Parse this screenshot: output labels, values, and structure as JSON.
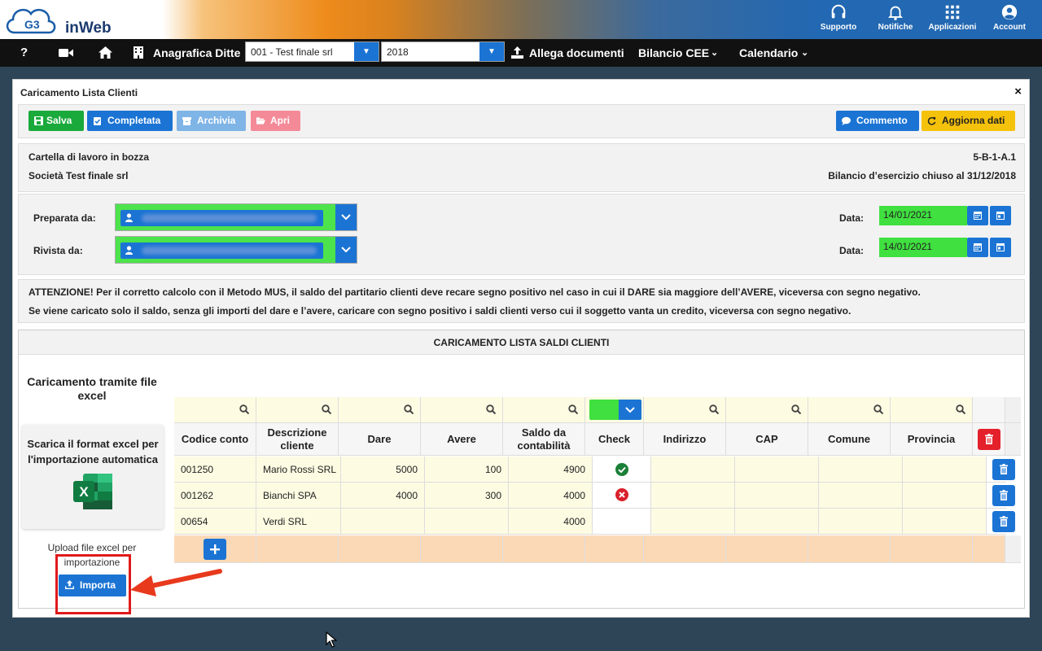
{
  "header": {
    "logo_badge": "G3",
    "logo_text": "inWeb",
    "items": [
      {
        "label": "Supporto",
        "icon": "headset-icon"
      },
      {
        "label": "Notifiche",
        "icon": "bell-icon"
      },
      {
        "label": "Applicazioni",
        "icon": "apps-grid-icon"
      },
      {
        "label": "Account",
        "icon": "account-icon"
      }
    ]
  },
  "nav": {
    "help": "?",
    "anagrafica": "Anagrafica Ditte",
    "company_select": "001 - Test finale srl",
    "year_select": "2018",
    "allega": "Allega documenti",
    "bilancio": "Bilancio CEE",
    "calendario": "Calendario"
  },
  "panel": {
    "title": "Caricamento Lista Clienti",
    "close": "×",
    "buttons": {
      "salva": "Salva",
      "completata": "Completata",
      "archivia": "Archivia",
      "apri": "Apri",
      "commento": "Commento",
      "aggiorna": "Aggiorna dati"
    },
    "info": {
      "status": "Cartella di lavoro in bozza",
      "company": "Società Test finale srl",
      "code": "5-B-1-A.1",
      "balance": "Bilancio d’esercizio chiuso al 31/12/2018"
    },
    "prep": {
      "preparata_label": "Preparata da:",
      "rivista_label": "Rivista da:",
      "data_label": "Data:",
      "preparata_date": "14/01/2021",
      "rivista_date": "14/01/2021"
    },
    "warning": {
      "line1": "ATTENZIONE! Per il corretto calcolo con il Metodo MUS, il saldo del partitario clienti deve recare segno positivo nel caso in cui il DARE sia maggiore dell’AVERE, viceversa con segno negativo.",
      "line2": "Se viene caricato solo il saldo, senza gli importi del dare e l’avere, caricare con segno positivo i saldi clienti verso cui il soggetto vanta un credito, viceversa con segno negativo."
    },
    "section_title": "CARICAMENTO LISTA SALDI CLIENTI",
    "excel": {
      "title": "Caricamento tramite file excel",
      "card_text": "Scarica il format excel per l'importazione automatica",
      "upload_label": "Upload file excel per importazione",
      "import_button": "Importa"
    },
    "table": {
      "columns": [
        "Codice conto",
        "Descrizione cliente",
        "Dare",
        "Avere",
        "Saldo da contabilità",
        "Check",
        "Indirizzo",
        "CAP",
        "Comune",
        "Provincia"
      ],
      "rows": [
        {
          "codice": "001250",
          "descrizione": "Mario Rossi SRL",
          "dare": "5000",
          "avere": "100",
          "saldo": "4900",
          "check": "ok"
        },
        {
          "codice": "001262",
          "descrizione": "Bianchi SPA",
          "dare": "4000",
          "avere": "300",
          "saldo": "4000",
          "check": "error"
        },
        {
          "codice": "00654",
          "descrizione": "Verdi SRL",
          "dare": "",
          "avere": "",
          "saldo": "4000",
          "check": ""
        }
      ]
    }
  },
  "colors": {
    "primary": "#1b74d4",
    "success": "#1aa93b",
    "danger": "#e4202b",
    "warning": "#f5c20b",
    "highlight_green": "#3fe03f"
  }
}
